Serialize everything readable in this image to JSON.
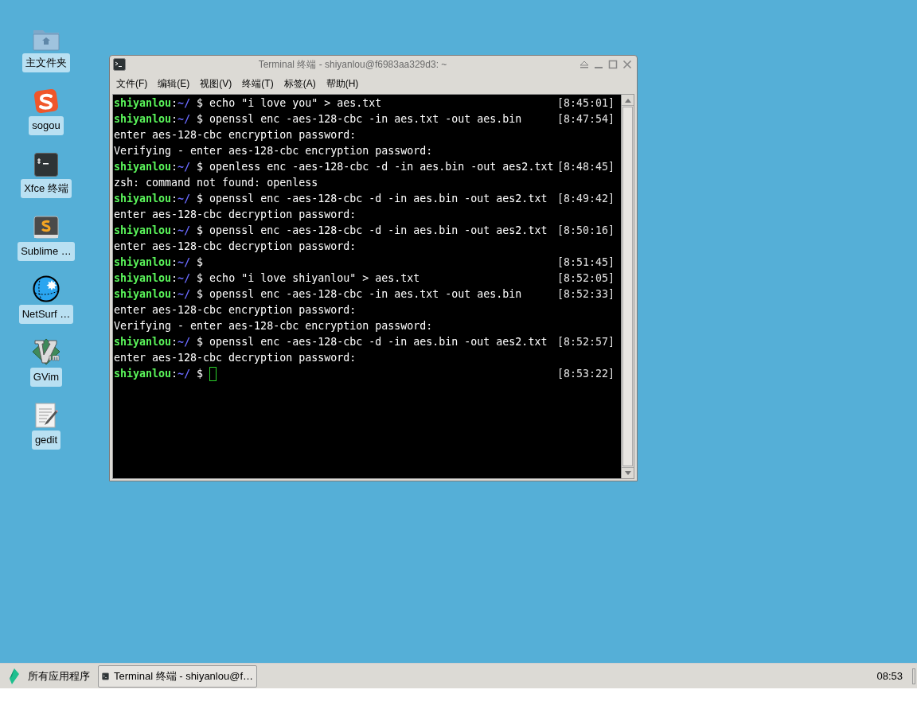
{
  "desktop_icons": [
    {
      "kind": "folder",
      "label": "主文件夹"
    },
    {
      "kind": "sogou",
      "label": "sogou"
    },
    {
      "kind": "terminal",
      "label": "Xfce 终端"
    },
    {
      "kind": "sublime",
      "label": "Sublime …"
    },
    {
      "kind": "netsurf",
      "label": "NetSurf …"
    },
    {
      "kind": "vim",
      "label": "GVim"
    },
    {
      "kind": "editor",
      "label": "gedit"
    }
  ],
  "window": {
    "title": "Terminal 终端 - shiyanlou@f6983aa329d3: ~",
    "menu": [
      "文件(F)",
      "编辑(E)",
      "视图(V)",
      "终端(T)",
      "标签(A)",
      "帮助(H)"
    ],
    "lines": [
      {
        "kind": "prompt",
        "user": "shiyanlou",
        "separator": ":",
        "path": "~/",
        "symbol": "$",
        "command": "echo \"i love you\" > aes.txt",
        "time": "[8:45:01]"
      },
      {
        "kind": "prompt",
        "user": "shiyanlou",
        "separator": ":",
        "path": "~/",
        "symbol": "$",
        "command": "openssl enc -aes-128-cbc -in aes.txt -out aes.bin",
        "time": "[8:47:54]"
      },
      {
        "kind": "output",
        "text": "enter aes-128-cbc encryption password:"
      },
      {
        "kind": "output",
        "text": "Verifying - enter aes-128-cbc encryption password:"
      },
      {
        "kind": "prompt",
        "user": "shiyanlou",
        "separator": ":",
        "path": "~/",
        "symbol": "$",
        "command": "openless enc -aes-128-cbc -d -in aes.bin -out aes2.txt",
        "time": "[8:48:45]"
      },
      {
        "kind": "output",
        "text": "zsh: command not found: openless"
      },
      {
        "kind": "prompt",
        "user": "shiyanlou",
        "separator": ":",
        "path": "~/",
        "symbol": "$",
        "command": "openssl enc -aes-128-cbc -d -in aes.bin -out aes2.txt",
        "time": "[8:49:42]"
      },
      {
        "kind": "output",
        "text": "enter aes-128-cbc decryption password:"
      },
      {
        "kind": "prompt",
        "user": "shiyanlou",
        "separator": ":",
        "path": "~/",
        "symbol": "$",
        "command": "openssl enc -aes-128-cbc -d -in aes.bin -out aes2.txt",
        "time": "[8:50:16]"
      },
      {
        "kind": "output",
        "text": "enter aes-128-cbc decryption password:"
      },
      {
        "kind": "prompt",
        "user": "shiyanlou",
        "separator": ":",
        "path": "~/",
        "symbol": "$",
        "time": "[8:51:45]"
      },
      {
        "kind": "prompt",
        "user": "shiyanlou",
        "separator": ":",
        "path": "~/",
        "symbol": "$",
        "command": "echo \"i love shiyanlou\" > aes.txt",
        "time": "[8:52:05]"
      },
      {
        "kind": "prompt",
        "user": "shiyanlou",
        "separator": ":",
        "path": "~/",
        "symbol": "$",
        "command": "openssl enc -aes-128-cbc -in aes.txt -out aes.bin",
        "time": "[8:52:33]"
      },
      {
        "kind": "output",
        "text": "enter aes-128-cbc encryption password:"
      },
      {
        "kind": "output",
        "text": "Verifying - enter aes-128-cbc encryption password:"
      },
      {
        "kind": "prompt",
        "user": "shiyanlou",
        "separator": ":",
        "path": "~/",
        "symbol": "$",
        "command": "openssl enc -aes-128-cbc -d -in aes.bin -out aes2.txt",
        "time": "[8:52:57]"
      },
      {
        "kind": "output",
        "text": "enter aes-128-cbc decryption password:"
      },
      {
        "kind": "prompt",
        "user": "shiyanlou",
        "separator": ":",
        "path": "~/",
        "symbol": "$",
        "time": "[8:53:22]",
        "cursor": true
      }
    ]
  },
  "taskbar": {
    "menu_label": "所有应用程序",
    "task": "Terminal 终端 - shiyanlou@f…",
    "clock": "08:53"
  }
}
